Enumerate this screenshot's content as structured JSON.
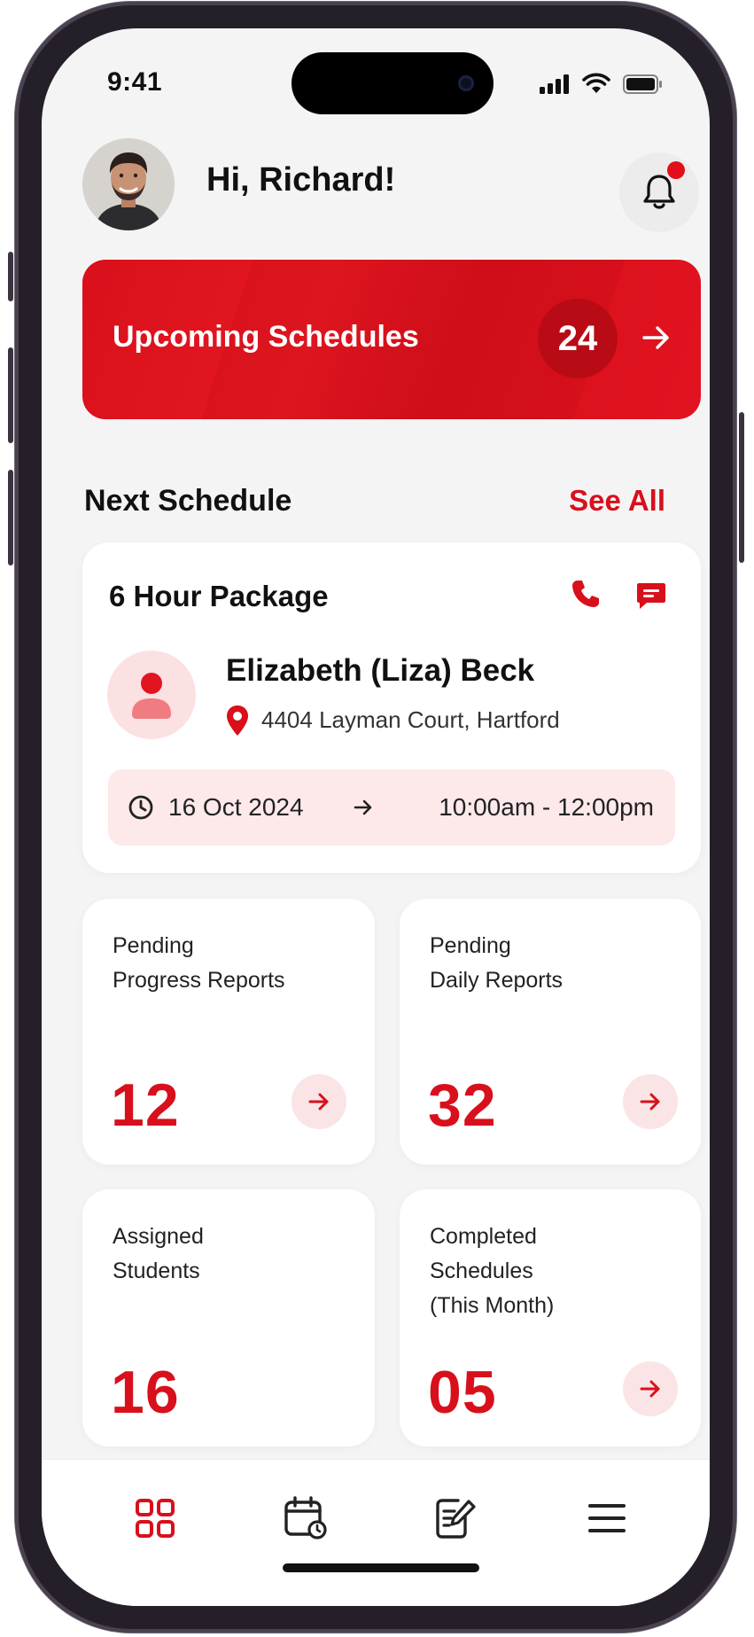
{
  "status_bar": {
    "time": "9:41"
  },
  "header": {
    "greeting": "Hi, Richard!",
    "avatar_icon": "user-avatar-photo",
    "notification_icon": "bell-icon"
  },
  "banner": {
    "title": "Upcoming Schedules",
    "count": "24",
    "arrow_icon": "arrow-right-icon"
  },
  "next_schedule": {
    "section_title": "Next Schedule",
    "see_all": "See All",
    "package": "6 Hour Package",
    "student_name": "Elizabeth (Liza) Beck",
    "address": "4404 Layman Court, Hartford",
    "date": "16 Oct 2024",
    "time_range": "10:00am - 12:00pm"
  },
  "stats": [
    {
      "label": "Pending\nProgress Reports",
      "value": "12",
      "has_arrow": true
    },
    {
      "label": "Pending\nDaily Reports",
      "value": "32",
      "has_arrow": true
    },
    {
      "label": "Assigned\nStudents",
      "value": "16",
      "has_arrow": false
    },
    {
      "label": "Completed\nSchedules\n(This Month)",
      "value": "05",
      "has_arrow": true
    }
  ],
  "tab_bar": [
    {
      "icon": "dashboard-grid-icon",
      "active": true
    },
    {
      "icon": "calendar-clock-icon",
      "active": false
    },
    {
      "icon": "report-edit-icon",
      "active": false
    },
    {
      "icon": "menu-icon",
      "active": false
    }
  ],
  "colors": {
    "accent": "#D8101B",
    "accent_soft": "#FBE4E5",
    "background": "#F4F4F4",
    "text": "#111111"
  }
}
